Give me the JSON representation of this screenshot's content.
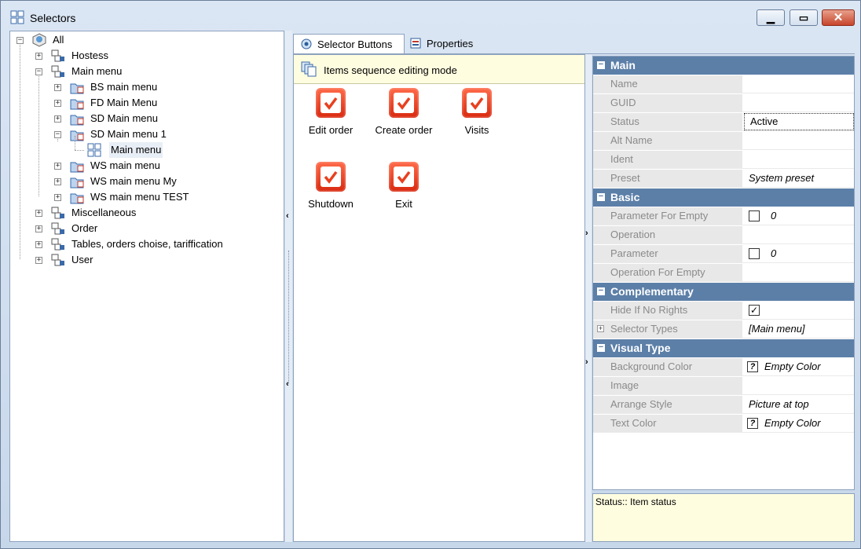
{
  "window": {
    "title": "Selectors",
    "title_icon": "grid-icon"
  },
  "tree": {
    "items": [
      {
        "label": "All",
        "icon": "globe-box-icon",
        "expander": "−"
      },
      {
        "label": "Hostess",
        "icon": "folder-icon",
        "expander": "+"
      },
      {
        "label": "Main menu",
        "icon": "folder-icon",
        "expander": "−"
      },
      {
        "label": "BS main menu",
        "icon": "selector-folder-icon",
        "expander": "+"
      },
      {
        "label": "FD Main Menu",
        "icon": "selector-folder-icon",
        "expander": "+"
      },
      {
        "label": "SD Main menu",
        "icon": "selector-folder-icon",
        "expander": "+"
      },
      {
        "label": "SD Main menu 1",
        "icon": "selector-folder-icon",
        "expander": "−"
      },
      {
        "label": "Main menu",
        "icon": "grid-icon",
        "expander": ""
      },
      {
        "label": "WS main menu",
        "icon": "selector-folder-icon",
        "expander": "+"
      },
      {
        "label": "WS main menu My",
        "icon": "selector-folder-icon",
        "expander": "+"
      },
      {
        "label": "WS main menu TEST",
        "icon": "selector-folder-icon",
        "expander": "+"
      },
      {
        "label": "Miscellaneous",
        "icon": "folder-icon",
        "expander": "+"
      },
      {
        "label": "Order",
        "icon": "folder-icon",
        "expander": "+"
      },
      {
        "label": "Tables, orders choise, tariffication",
        "icon": "folder-icon",
        "expander": "+"
      },
      {
        "label": "User",
        "icon": "folder-icon",
        "expander": "+"
      }
    ]
  },
  "tabs": [
    {
      "label": "Selector Buttons",
      "icon": "selector-icon",
      "active": true
    },
    {
      "label": "Properties",
      "icon": "properties-icon",
      "active": false
    }
  ],
  "editing": {
    "banner": "Items sequence editing mode",
    "buttons": [
      {
        "label": "Edit order"
      },
      {
        "label": "Create order"
      },
      {
        "label": "Visits"
      },
      {
        "label": "Shutdown"
      },
      {
        "label": "Exit"
      }
    ]
  },
  "properties": {
    "categories": [
      {
        "name": "Main",
        "rows": [
          {
            "name": "Name",
            "value": ""
          },
          {
            "name": "GUID",
            "value": ""
          },
          {
            "name": "Status",
            "value": "Active"
          },
          {
            "name": "Alt Name",
            "value": ""
          },
          {
            "name": "Ident",
            "value": ""
          },
          {
            "name": "Preset",
            "value": "System preset"
          }
        ]
      },
      {
        "name": "Basic",
        "rows": [
          {
            "name": "Parameter For Empty",
            "value": "0",
            "checkbox": false
          },
          {
            "name": "Operation",
            "value": ""
          },
          {
            "name": "Parameter",
            "value": "0",
            "checkbox": false
          },
          {
            "name": "Operation For Empty",
            "value": ""
          }
        ]
      },
      {
        "name": "Complementary",
        "rows": [
          {
            "name": "Hide If No Rights",
            "value": "",
            "checkbox": true
          },
          {
            "name": "Selector Types",
            "value": "[Main menu]"
          }
        ]
      },
      {
        "name": "Visual Type",
        "rows": [
          {
            "name": "Background Color",
            "value": "Empty Color"
          },
          {
            "name": "Image",
            "value": ""
          },
          {
            "name": "Arrange Style",
            "value": "Picture at top"
          },
          {
            "name": "Text Color",
            "value": "Empty Color"
          }
        ]
      }
    ]
  },
  "status_panel": {
    "text": "Status:: Item status"
  },
  "colors": {
    "category_header": "#5c7fa8",
    "button_red": "#e8401f",
    "banner_bg": "#fffde0"
  }
}
